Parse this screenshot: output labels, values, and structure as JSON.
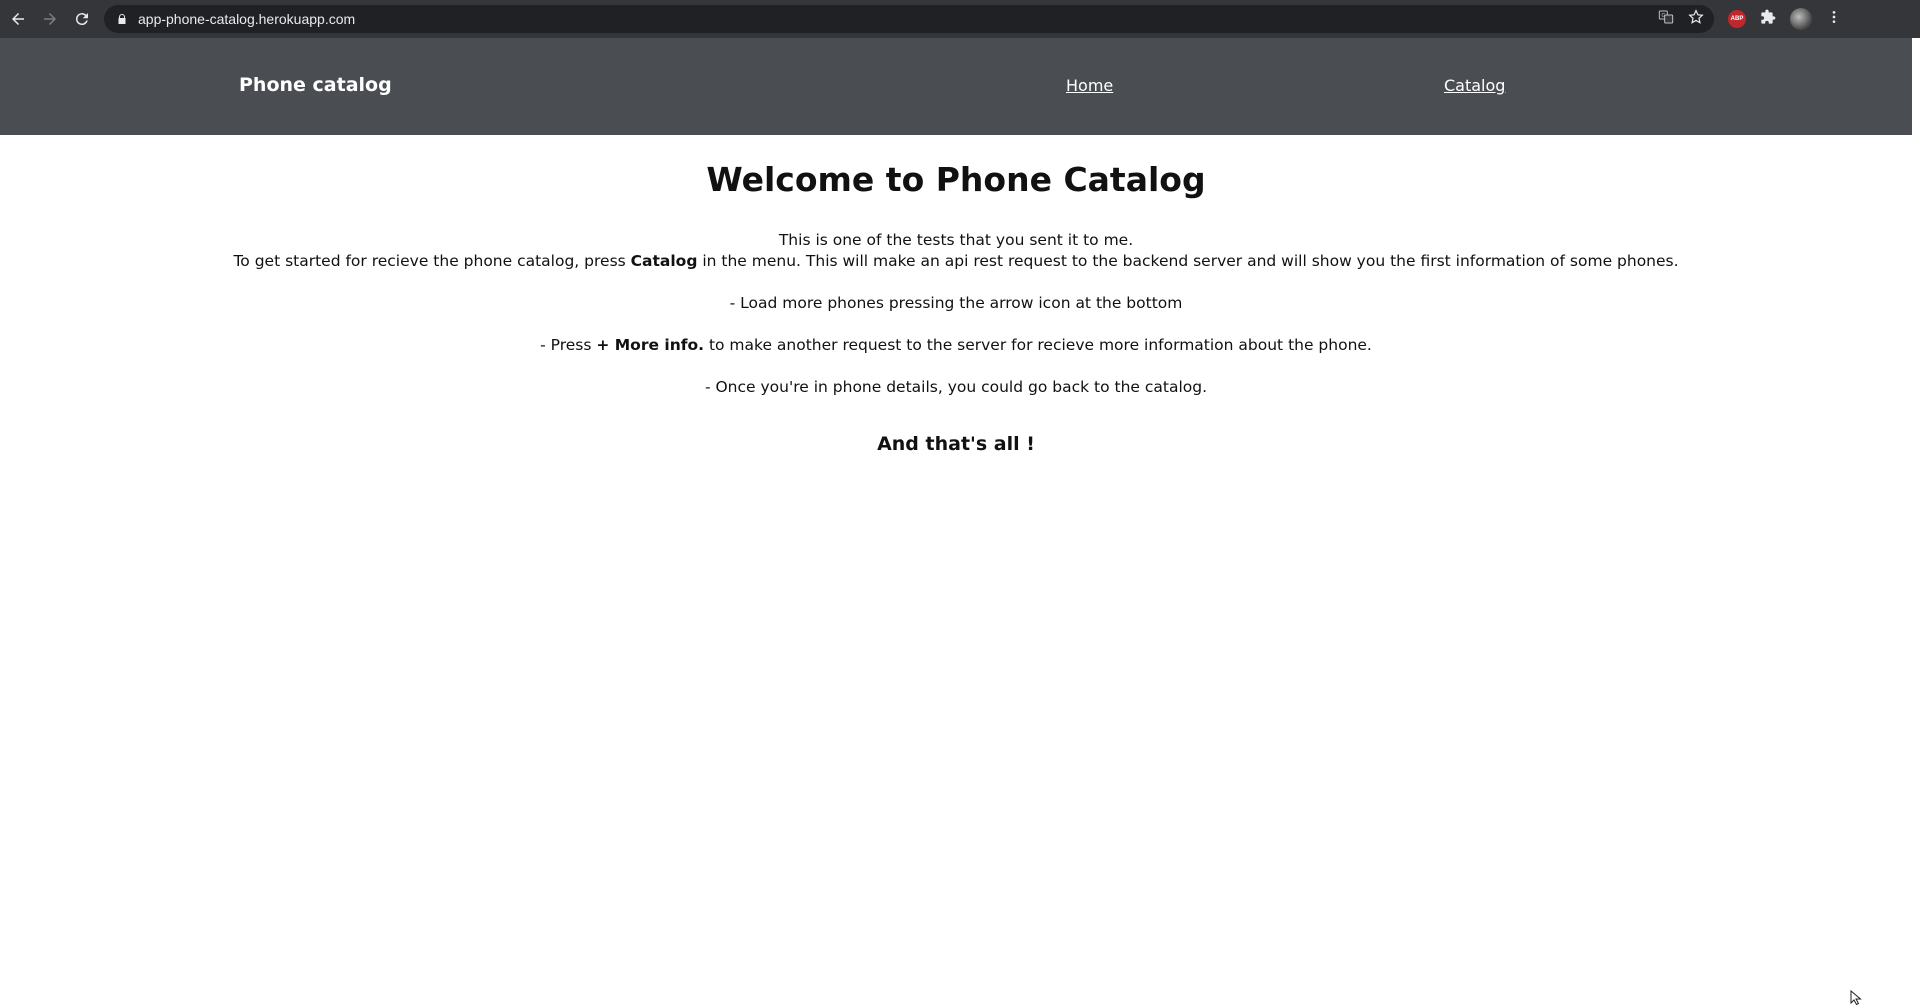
{
  "browser": {
    "url": "app-phone-catalog.herokuapp.com",
    "icons": [
      "back-icon",
      "forward-icon",
      "reload-icon",
      "lock-icon",
      "translate-icon",
      "star-icon",
      "adblock-icon",
      "puzzle-icon",
      "profile-avatar",
      "kebab-menu-icon"
    ],
    "adblock_label": "ABP"
  },
  "navbar": {
    "brand": "Phone catalog",
    "links": [
      {
        "label": "Home"
      },
      {
        "label": "Catalog"
      }
    ],
    "background": "#4a4e53"
  },
  "main": {
    "title": "Welcome to Phone Catalog",
    "intro_line1": "This is one of the tests that you sent it to me.",
    "intro_line2_pre": "To get started for recieve the phone catalog, press ",
    "intro_line2_bold": "Catalog",
    "intro_line2_post": " in the menu. This will make an api rest request to the backend server and will show you the first information of some phones.",
    "bullet1": "- Load more phones pressing the arrow icon at the bottom",
    "bullet2_pre": "- Press ",
    "bullet2_bold": "+ More info.",
    "bullet2_post": " to make another request to the server for recieve more information about the phone.",
    "bullet3": "- Once you're in phone details, you could go back to the catalog.",
    "closing": "And that's all !"
  }
}
